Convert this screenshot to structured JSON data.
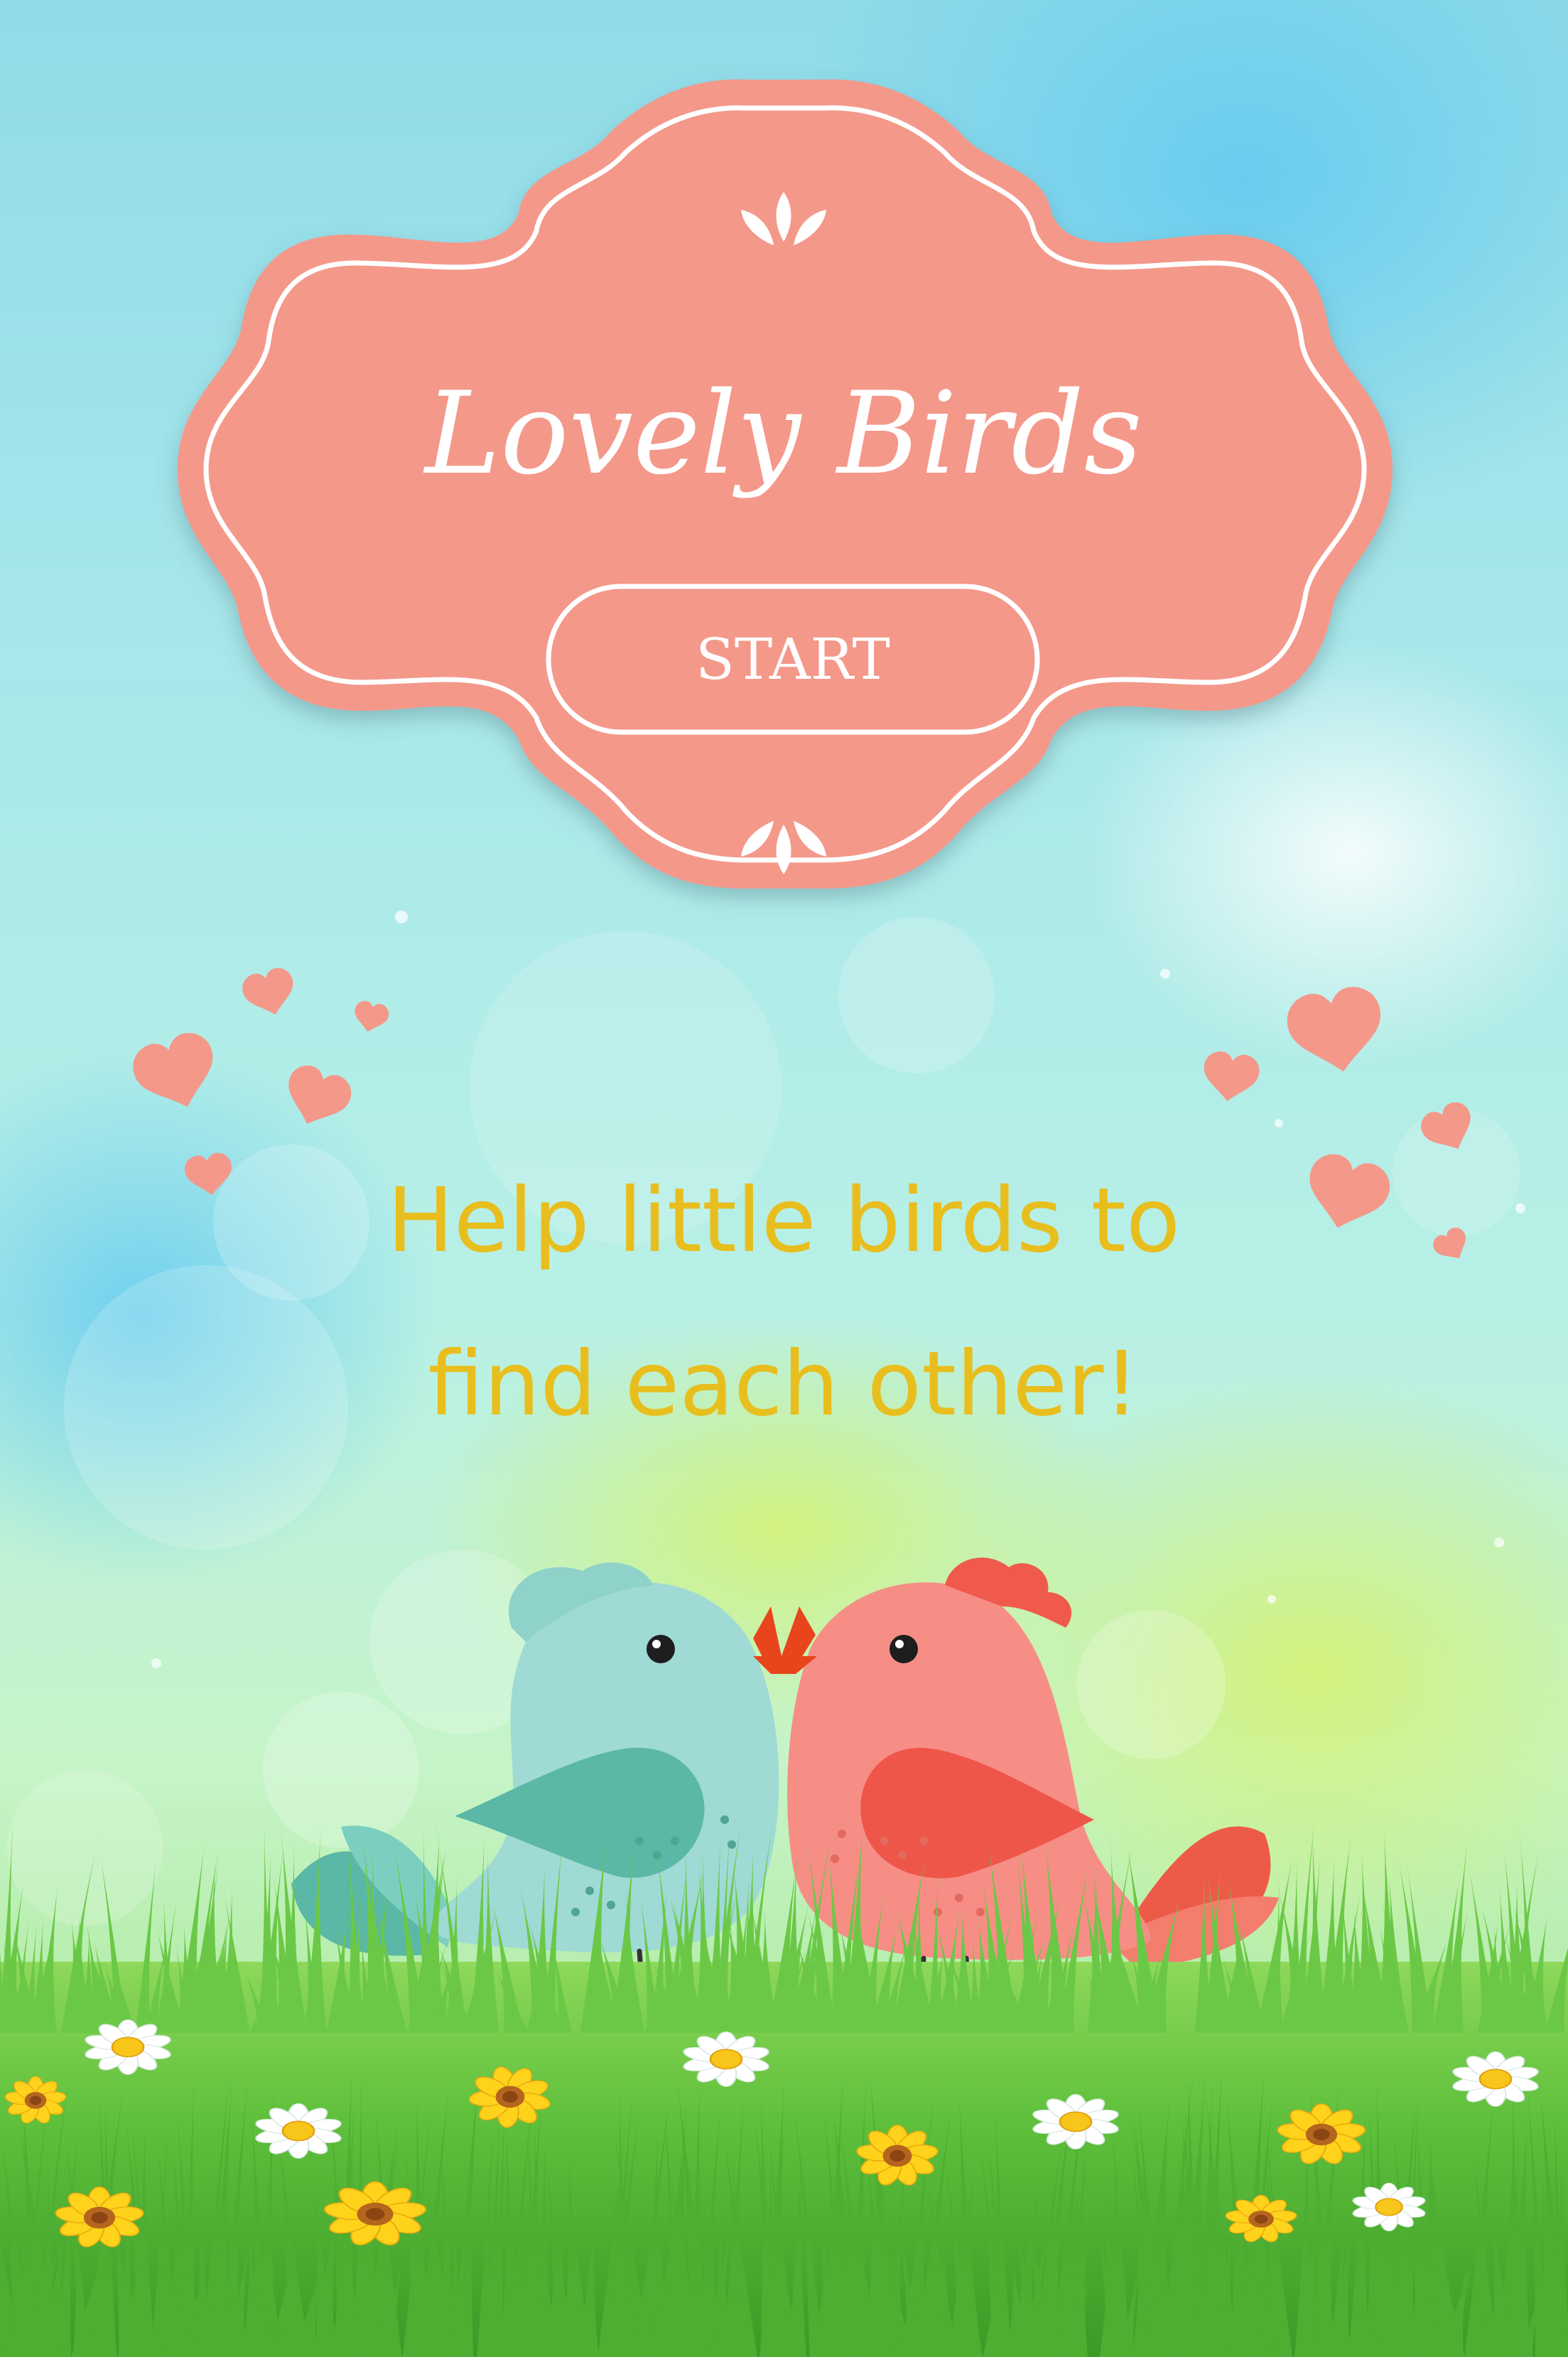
{
  "game": {
    "title": "Lovely Birds",
    "start_label": "START",
    "tagline_line1": "Help little birds to",
    "tagline_line2": "find each other!"
  },
  "colors": {
    "coral": "#F4988A",
    "coral_dark": "#E5786A",
    "tagline": "#E8BE1E",
    "sky_top": "#7FD4EE",
    "grass": "#4CB83A",
    "blue_bird": "#9FDAD5",
    "pink_bird": "#F68E86",
    "beak": "#E8451C"
  },
  "icons": {
    "badge_ornament": "leaf-sprig-icon",
    "hearts": "heart-icon",
    "flowers": "daisy-icon"
  }
}
